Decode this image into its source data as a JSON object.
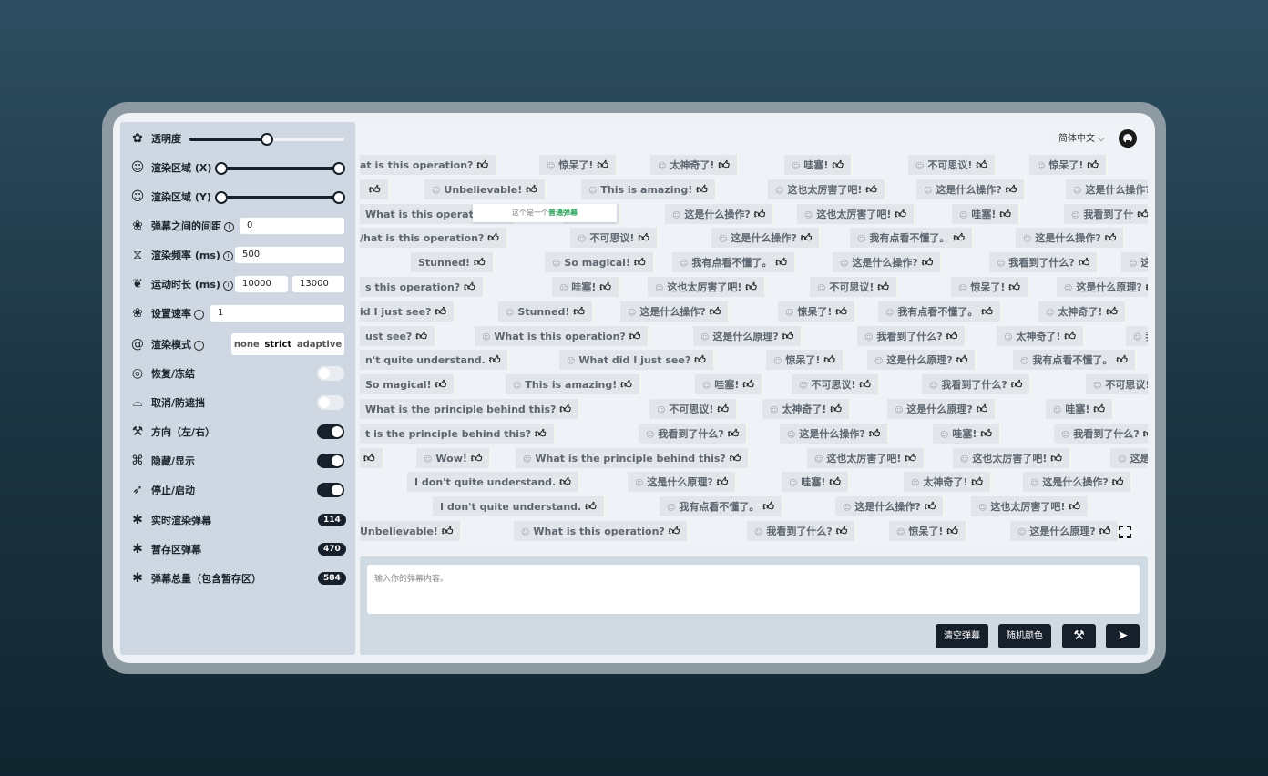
{
  "sidebar": {
    "opacity_label": "透明度",
    "opacity_value": 0.5,
    "area_x_label": "渲染区域 (X)",
    "area_y_label": "渲染区域 (Y)",
    "gap_label": "弹幕之间的间距",
    "gap_value": "0",
    "freq_label": "渲染频率 (ms)",
    "freq_value": "500",
    "duration_label": "运动时长 (ms)",
    "duration_min": "10000",
    "duration_max": "13000",
    "rate_label": "设置速率",
    "rate_value": "1",
    "mode_label": "渲染模式",
    "mode_options": [
      "none",
      "strict",
      "adaptive"
    ],
    "mode_selected": "strict",
    "resume_label": "恢复/冻结",
    "cancel_label": "取消/防遮挡",
    "direction_label": "方向（左/右）",
    "hide_label": "隐藏/显示",
    "stop_label": "停止/启动",
    "realtime_label": "实时渲染弹幕",
    "realtime_count": "114",
    "stash_label": "暂存区弹幕",
    "stash_count": "470",
    "total_label": "弹幕总量（包含暂存区）",
    "total_count": "584"
  },
  "header": {
    "language": "简体中文 ⌵"
  },
  "popup": {
    "prefix": "这个是一个",
    "highlight": "普通弹幕"
  },
  "danmaku": [
    [
      "at is this operation?",
      "惊呆了!",
      "太神奇了!",
      "哇塞!",
      "不可思议!",
      "惊呆了!",
      "这"
    ],
    [
      "",
      "Unbelievable!",
      "This is amazing!",
      "这也太厉害了吧!",
      "这是什么操作?",
      "这是什么操作?",
      "这是什么操作?"
    ],
    [
      "What is this operation",
      "了!",
      "这是什么操作?",
      "这也太厉害了吧!",
      "哇塞!",
      "我看到了什"
    ],
    [
      "/hat is this operation?",
      "不可思议!",
      "这是什么操作?",
      "我有点看不懂了。",
      "这是什么操作?",
      "太神奇了"
    ],
    [
      "Stunned!",
      "So magical!",
      "我有点看不懂了。",
      "这是什么操作?",
      "我看到了什么?",
      "这也太厉"
    ],
    [
      "s this operation?",
      "哇塞!",
      "这也太厉害了吧!",
      "不可思议!",
      "惊呆了!",
      "这是什么原理?"
    ],
    [
      "id I just see?",
      "Stunned!",
      "这是什么操作?",
      "惊呆了!",
      "我有点看不懂了。",
      "太神奇了!",
      "我"
    ],
    [
      "ust see?",
      "What is this operation?",
      "这是什么原理?",
      "我看到了什么?",
      "太神奇了!",
      "我有点看不懂了。"
    ],
    [
      "n't quite understand.",
      "What did I just see?",
      "惊呆了!",
      "这是什么原理?",
      "我有点看不懂了。",
      "这是什么"
    ],
    [
      "So magical!",
      "This is amazing!",
      "哇塞!",
      "不可思议!",
      "我看到了什么?",
      "不可思议!",
      "不可思议!"
    ],
    [
      "What is the principle behind this?",
      "不可思议!",
      "太神奇了!",
      "这是什么原理?",
      "哇塞!"
    ],
    [
      "t is the principle behind this?",
      "我看到了什么?",
      "这是什么操作?",
      "哇塞!",
      "我看到了什么?"
    ],
    [
      "",
      "Wow!",
      "What is the principle behind this?",
      "这也太厉害了吧!",
      "这也太厉害了吧!",
      "这是什么操作?"
    ],
    [
      "I don't quite understand.",
      "这是什么原理?",
      "哇塞!",
      "太神奇了!",
      "这是什么操作?",
      "这"
    ],
    [
      "I don't quite understand.",
      "我有点看不懂了。",
      "这是什么操作?",
      "这也太厉害了吧!"
    ],
    [
      "Unbelievable!",
      "What is this operation?",
      "我看到了什么?",
      "惊呆了!",
      "这是什么原理?",
      "惊呆"
    ]
  ],
  "input": {
    "placeholder": "输入你的弹幕内容。"
  },
  "buttons": {
    "clear": "清空弹幕",
    "random_color": "随机颜色"
  }
}
